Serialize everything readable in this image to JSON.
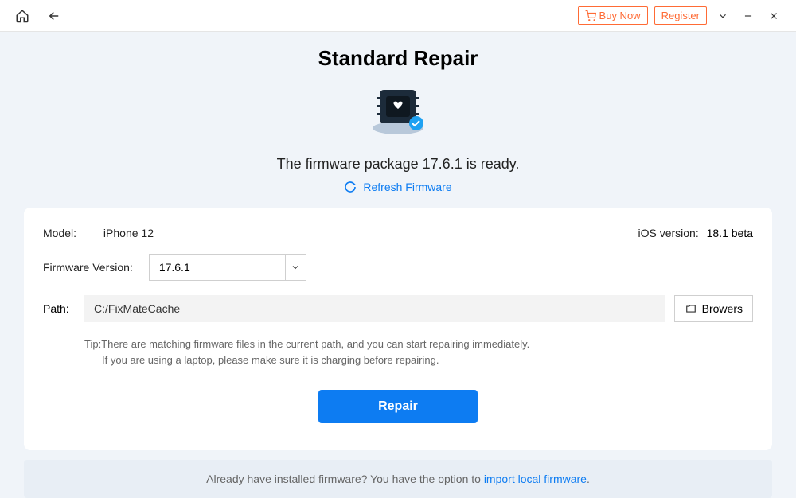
{
  "topbar": {
    "buy_now": "Buy Now",
    "register": "Register"
  },
  "page": {
    "title": "Standard Repair",
    "firmware_ready": "The firmware package 17.6.1 is ready.",
    "refresh": "Refresh Firmware"
  },
  "info": {
    "model_label": "Model:",
    "model_value": "iPhone 12",
    "ios_version_label": "iOS version:",
    "ios_version_value": "18.1 beta",
    "firmware_version_label": "Firmware Version:",
    "firmware_version_value": "17.6.1",
    "path_label": "Path:",
    "path_value": "C:/FixMateCache",
    "browse": "Browers"
  },
  "tip": {
    "prefix": "Tip:",
    "line1": "There are matching firmware files in the current path, and you can start repairing immediately.",
    "line2": "If you are using a laptop, please make sure it is charging before repairing."
  },
  "actions": {
    "repair": "Repair"
  },
  "footer": {
    "text": "Already have installed firmware? You have the option to ",
    "link": "import local firmware",
    "period": "."
  }
}
